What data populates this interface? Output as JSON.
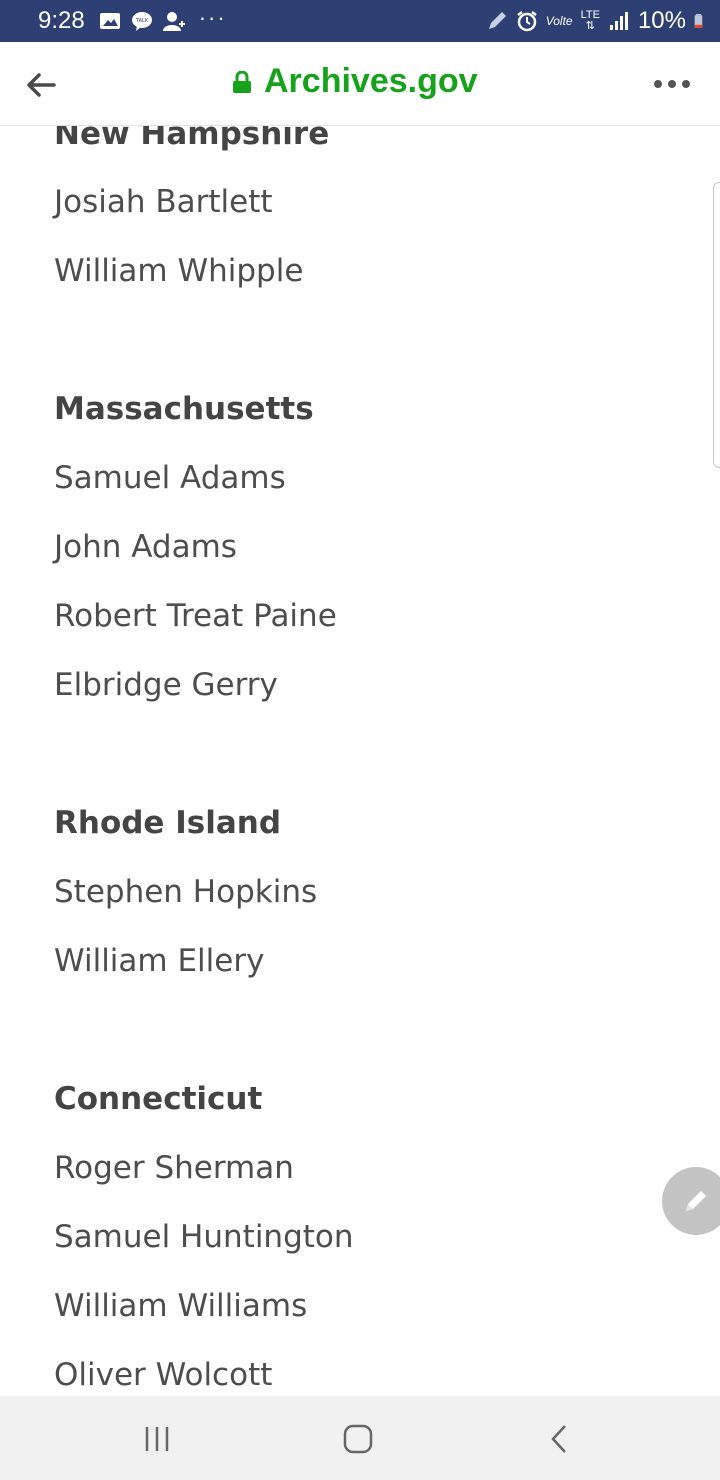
{
  "status_bar": {
    "time": "9:28",
    "dots": "···",
    "volte": "Volte",
    "lte": "LTE",
    "battery": "10%"
  },
  "browser": {
    "url": "Archives.gov"
  },
  "sections": [
    {
      "heading": "New Hampshire",
      "signers": [
        "Josiah Bartlett",
        "William Whipple"
      ]
    },
    {
      "heading": "Massachusetts",
      "signers": [
        "Samuel Adams",
        "John Adams",
        "Robert Treat Paine",
        "Elbridge Gerry"
      ]
    },
    {
      "heading": "Rhode Island",
      "signers": [
        "Stephen Hopkins",
        "William Ellery"
      ]
    },
    {
      "heading": "Connecticut",
      "signers": [
        "Roger Sherman",
        "Samuel Huntington",
        "William Williams",
        "Oliver Wolcott"
      ]
    }
  ],
  "colors": {
    "status_bar": "#2e3f73",
    "url_green": "#17a21b",
    "heading_text": "#444444",
    "body_text": "#4d4d4d",
    "nav_bar": "#f1f1f1"
  }
}
